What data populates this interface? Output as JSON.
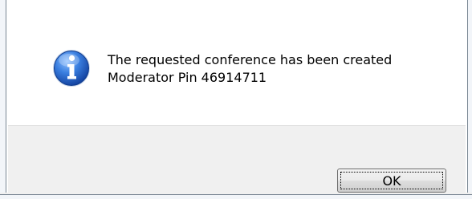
{
  "dialog": {
    "message_line1": "The requested conference has been created",
    "message_line2": "Moderator Pin 46914711",
    "icon": "information-icon",
    "ok_label": "OK"
  },
  "colors": {
    "icon_blue": "#2a66c8",
    "button_area": "#f0f0f0"
  }
}
